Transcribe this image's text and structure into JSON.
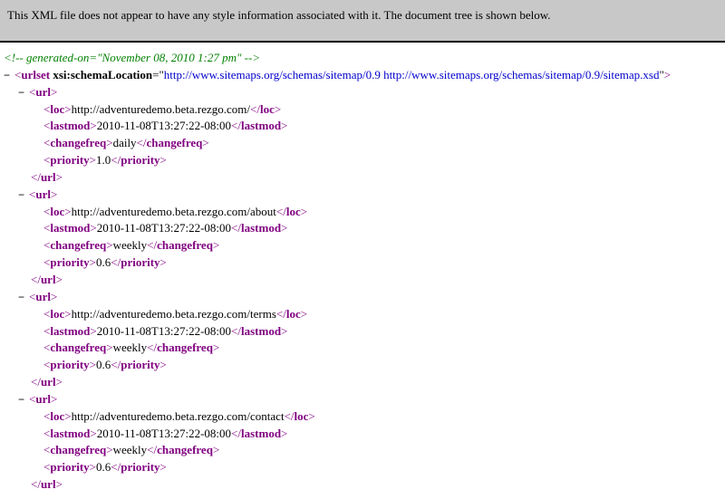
{
  "header_msg": "This XML file does not appear to have any style information associated with it. The document tree is shown below.",
  "marker": "−",
  "br_open": "<",
  "br_close": ">",
  "br_end": "</",
  "comment_open": "<!--",
  "comment_close": "-->",
  "comment_text": " generated-on=\"November 08, 2010 1:27 pm\" ",
  "root": {
    "tag": "urlset",
    "attr_name": "xsi:schemaLocation",
    "eq": "=\"",
    "attr_val": "http://www.sitemaps.org/schemas/sitemap/0.9 http://www.sitemaps.org/schemas/sitemap/0.9/sitemap.xsd",
    "q": "\""
  },
  "tags": {
    "url": "url",
    "loc": "loc",
    "lastmod": "lastmod",
    "changefreq": "changefreq",
    "priority": "priority"
  },
  "urls": [
    {
      "loc": "http://adventuredemo.beta.rezgo.com/",
      "lastmod": "2010-11-08T13:27:22-08:00",
      "changefreq": "daily",
      "priority": "1.0"
    },
    {
      "loc": "http://adventuredemo.beta.rezgo.com/about",
      "lastmod": "2010-11-08T13:27:22-08:00",
      "changefreq": "weekly",
      "priority": "0.6"
    },
    {
      "loc": "http://adventuredemo.beta.rezgo.com/terms",
      "lastmod": "2010-11-08T13:27:22-08:00",
      "changefreq": "weekly",
      "priority": "0.6"
    },
    {
      "loc": "http://adventuredemo.beta.rezgo.com/contact",
      "lastmod": "2010-11-08T13:27:22-08:00",
      "changefreq": "weekly",
      "priority": "0.6"
    }
  ]
}
